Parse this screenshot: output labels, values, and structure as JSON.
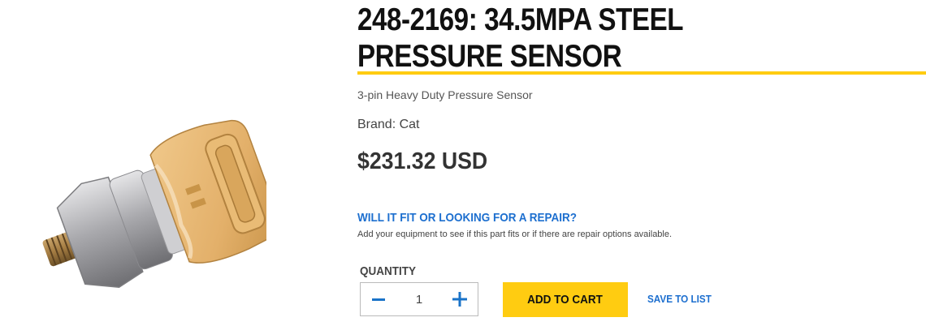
{
  "product": {
    "title": "248-2169: 34.5MPA STEEL PRESSURE SENSOR",
    "subtitle": "3-pin Heavy Duty Pressure Sensor",
    "brand": "Brand: Cat",
    "price": "$231.32 USD",
    "image_icon": "pressure-sensor-image"
  },
  "fit": {
    "link_label": "WILL IT FIT OR LOOKING FOR A REPAIR?",
    "description": "Add your equipment to see if this part fits or if there are repair options available."
  },
  "purchase": {
    "quantity_label": "QUANTITY",
    "quantity_value": "1",
    "decrement_icon": "minus-icon",
    "increment_icon": "plus-icon",
    "add_to_cart_label": "ADD TO CART",
    "save_to_list_label": "SAVE TO LIST"
  },
  "colors": {
    "accent_yellow": "#ffcc11",
    "link_blue": "#1d6fcf",
    "stepper_icon_blue": "#1a73c8"
  }
}
